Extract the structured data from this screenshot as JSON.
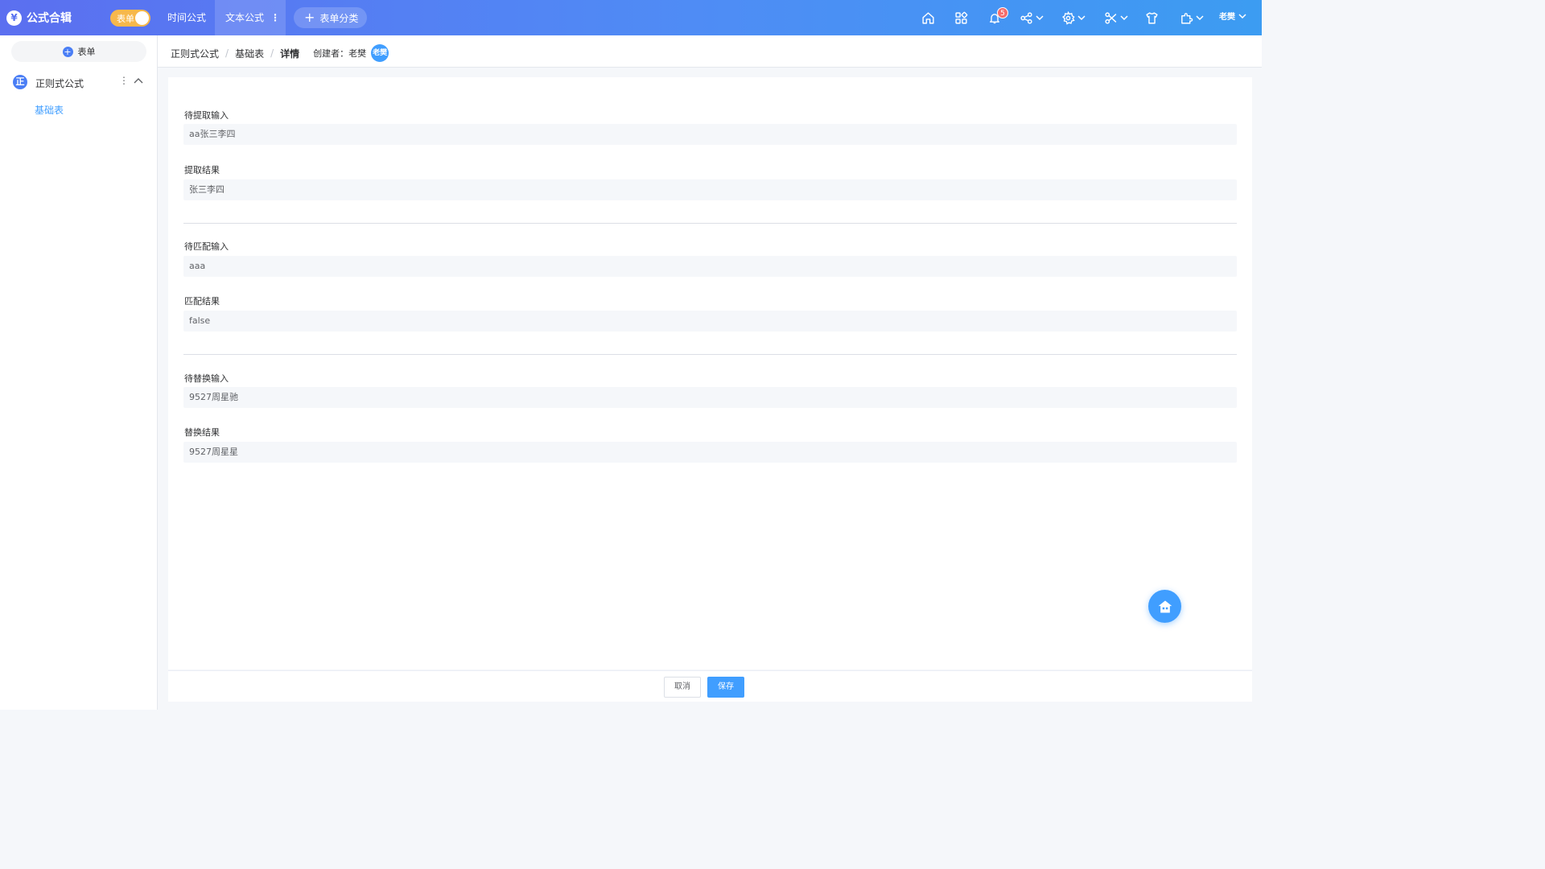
{
  "app": {
    "logo_glyph": "¥",
    "title": "公式合辑"
  },
  "topbar": {
    "mode_toggle_label": "表单",
    "tabs": [
      {
        "label": "时间公式",
        "active": false
      },
      {
        "label": "文本公式",
        "active": true,
        "menu_glyph": "⋮"
      }
    ],
    "add_category_label": "表单分类",
    "notification_count": "5",
    "user_name": "老樊",
    "icons": [
      "home-icon",
      "apps-icon",
      "bell-icon",
      "share-icon",
      "settings-icon",
      "tools-icon",
      "shirt-icon",
      "puzzle-icon"
    ]
  },
  "sidebar": {
    "add_form_label": "表单",
    "group": {
      "avatar_letter": "正",
      "label": "正则式公式",
      "more_glyph": "⋮",
      "expanded": true
    },
    "items": [
      {
        "label": "基础表",
        "active": true
      }
    ]
  },
  "breadcrumb": {
    "items": [
      "正则式公式",
      "基础表"
    ],
    "current": "详情",
    "separator": "/",
    "creator_label": "创建者：老樊",
    "creator_avatar": "老樊"
  },
  "form": {
    "fields": [
      {
        "label": "待提取输入",
        "value": "aa张三李四"
      },
      {
        "label": "提取结果",
        "value": "张三李四"
      },
      {
        "label": "待匹配输入",
        "value": "aaa"
      },
      {
        "label": "匹配结果",
        "value": "false"
      },
      {
        "label": "待替换输入",
        "value": "9527周星驰"
      },
      {
        "label": "替换结果",
        "value": "9527周星星"
      }
    ]
  },
  "footer": {
    "cancel_label": "取消",
    "save_label": "保存"
  },
  "colors": {
    "header_gradient_start": "#5b6ff0",
    "header_gradient_end": "#3c9cf2",
    "accent": "#409eff",
    "toggle": "#f7b84b",
    "badge": "#f56c6c"
  }
}
